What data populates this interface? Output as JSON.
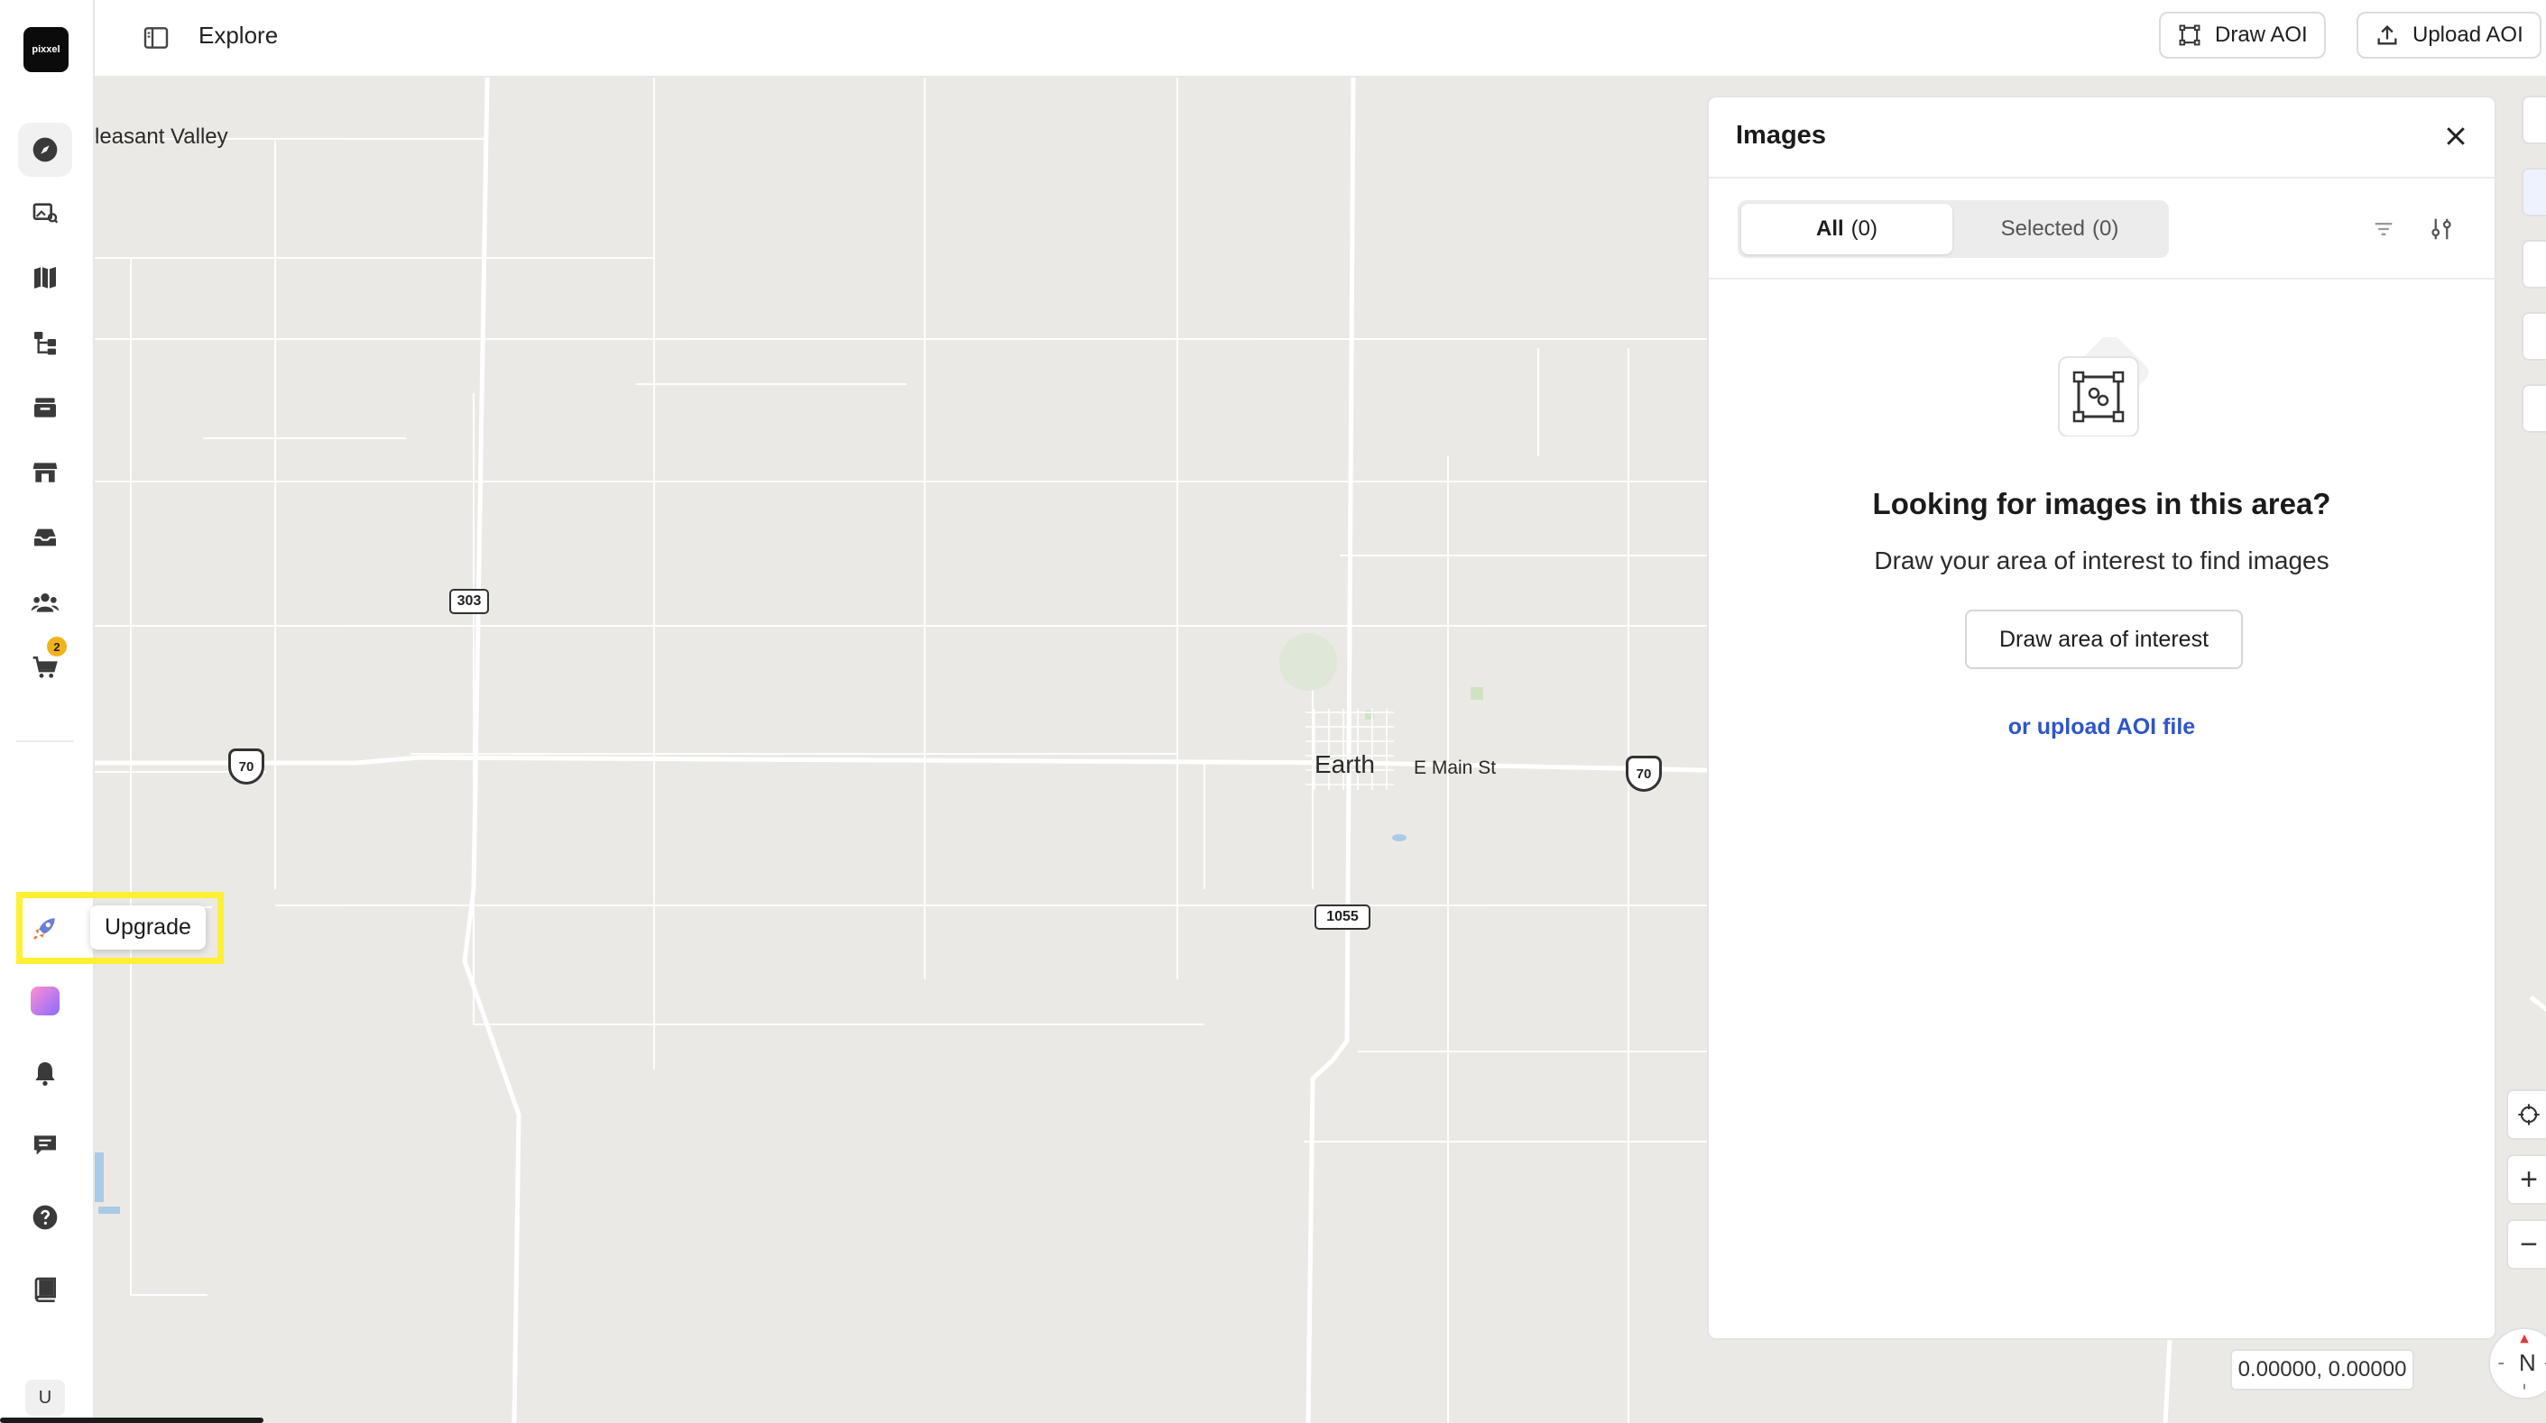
{
  "app": {
    "logo_text": "pixxel"
  },
  "header": {
    "title": "Explore",
    "draw_aoi_label": "Draw AOI",
    "upload_aoi_label": "Upload AOI"
  },
  "sidebar": {
    "items": [
      {
        "id": "explore",
        "icon": "compass-icon"
      },
      {
        "id": "images",
        "icon": "image-search-icon"
      },
      {
        "id": "maps",
        "icon": "map-icon"
      },
      {
        "id": "workflows",
        "icon": "workflow-icon"
      },
      {
        "id": "archive",
        "icon": "archive-icon"
      },
      {
        "id": "store",
        "icon": "store-icon"
      },
      {
        "id": "orders",
        "icon": "inbox-icon"
      },
      {
        "id": "team",
        "icon": "team-icon"
      },
      {
        "id": "cart",
        "icon": "cart-icon",
        "badge": "2"
      }
    ],
    "bottom": {
      "upgrade_label": "Upgrade",
      "user_initial": "U"
    }
  },
  "images_panel": {
    "title": "Images",
    "tabs": [
      {
        "label": "All",
        "count": "(0)"
      },
      {
        "label": "Selected",
        "count": "(0)"
      }
    ],
    "empty_title": "Looking for images in this area?",
    "empty_subtitle": "Draw your area of interest to find images",
    "draw_button_label": "Draw area of interest",
    "upload_link_label": "or upload AOI file"
  },
  "map": {
    "labels": {
      "pleasant_valley": "leasant Valley",
      "earth": "Earth",
      "e_main_st": "E Main St"
    },
    "route_shields": {
      "r303": "303",
      "r1055": "1055",
      "us70_west": "70",
      "us70_east": "70"
    },
    "controls": {
      "zoom_in": "+",
      "zoom_out": "−",
      "compass_label": "N"
    },
    "coordinates": "0.00000, 0.00000"
  },
  "colors": {
    "highlight": "#fff033",
    "link": "#2f55c8",
    "map_bg": "#ebe9e5",
    "badge": "#f2b31a"
  }
}
